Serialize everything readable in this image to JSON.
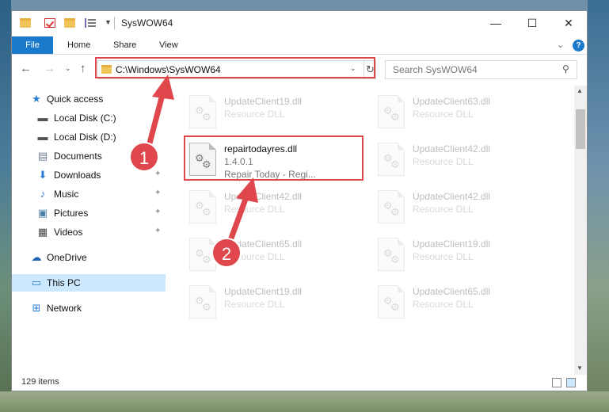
{
  "window": {
    "title": "SysWOW64"
  },
  "ribbon": {
    "tabs": [
      "File",
      "Home",
      "Share",
      "View"
    ]
  },
  "address": {
    "path": "C:\\Windows\\SysWOW64"
  },
  "search": {
    "placeholder": "Search SysWOW64"
  },
  "sidebar": {
    "items": [
      {
        "label": "Quick access",
        "icon": "star-icon"
      },
      {
        "label": "Local Disk (C:)",
        "icon": "drive-icon"
      },
      {
        "label": "Local Disk (D:)",
        "icon": "drive-icon"
      },
      {
        "label": "Documents",
        "icon": "documents-icon"
      },
      {
        "label": "Downloads",
        "icon": "download-arrow-icon"
      },
      {
        "label": "Music",
        "icon": "music-note-icon"
      },
      {
        "label": "Pictures",
        "icon": "pictures-icon"
      },
      {
        "label": "Videos",
        "icon": "videos-icon"
      },
      {
        "label": "OneDrive",
        "icon": "cloud-icon"
      },
      {
        "label": "This PC",
        "icon": "computer-icon"
      },
      {
        "label": "Network",
        "icon": "network-icon"
      }
    ]
  },
  "files": {
    "col1": [
      {
        "name": "UpdateClient19.dll",
        "type": "Resource DLL"
      },
      {
        "name": "repairtodayres.dll",
        "version": "1.4.0.1",
        "desc": "Repair Today - Regi..."
      },
      {
        "name": "UpdateClient42.dll",
        "type": "Resource DLL"
      },
      {
        "name": "UpdateClient65.dll",
        "type": "Resource DLL"
      },
      {
        "name": "UpdateClient19.dll",
        "type": "Resource DLL"
      }
    ],
    "col2": [
      {
        "name": "UpdateClient63.dll",
        "type": "Resource DLL"
      },
      {
        "name": "UpdateClient42.dll",
        "type": "Resource DLL"
      },
      {
        "name": "UpdateClient42.dll",
        "type": "Resource DLL"
      },
      {
        "name": "UpdateClient19.dll",
        "type": "Resource DLL"
      },
      {
        "name": "UpdateClient65.dll",
        "type": "Resource DLL"
      }
    ]
  },
  "status": {
    "item_count": "129 items"
  },
  "annotations": {
    "step1": "1",
    "step2": "2",
    "highlight_color": "#e0474c"
  },
  "colors": {
    "accent": "#1979ca",
    "selected": "#cce8ff"
  }
}
